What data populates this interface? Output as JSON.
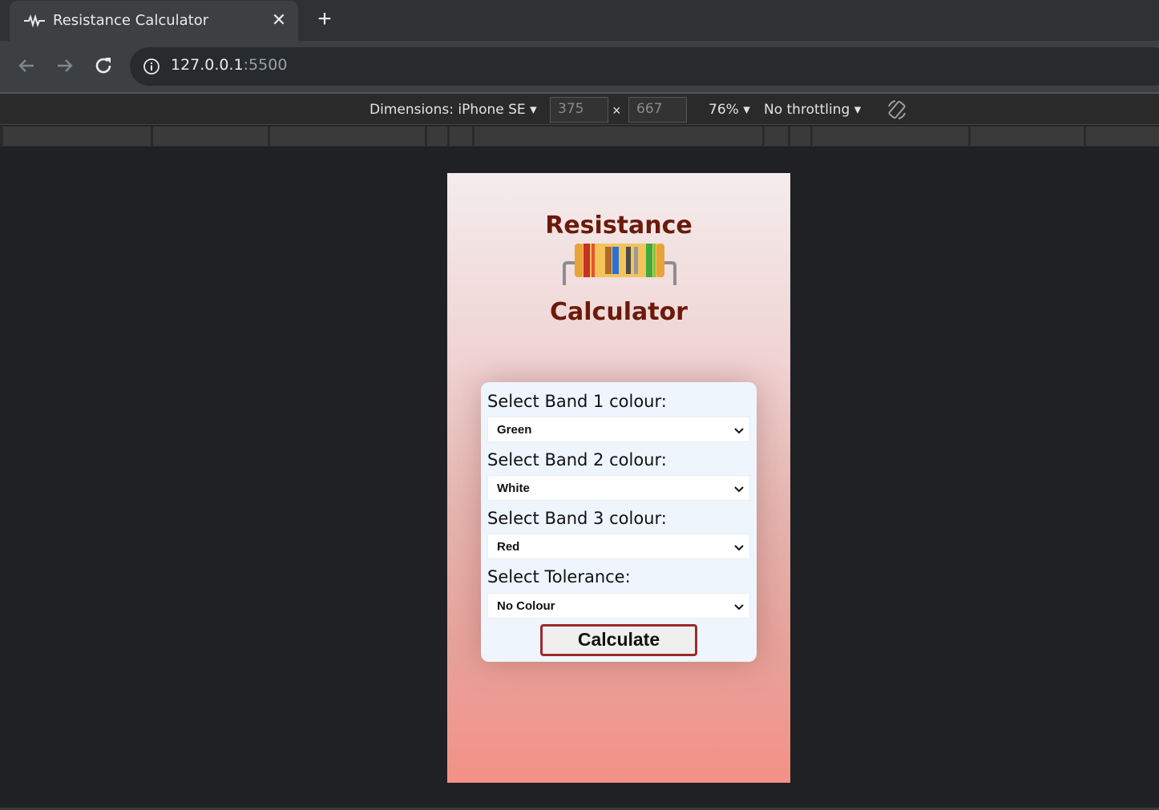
{
  "browser": {
    "tab_title": "Resistance Calculator",
    "url_host": "127.0.0.1",
    "url_port": ":5500"
  },
  "devtools": {
    "dimensions_label": "Dimensions: iPhone SE",
    "width_value": "375",
    "height_value": "667",
    "times": "×",
    "zoom": "76%",
    "throttling": "No throttling"
  },
  "app": {
    "title_top": "Resistance",
    "title_bottom": "Calculator",
    "fields": [
      {
        "label": "Select Band 1 colour:",
        "value": "Green"
      },
      {
        "label": "Select Band 2 colour:",
        "value": "White"
      },
      {
        "label": "Select Band 3 colour:",
        "value": "Red"
      },
      {
        "label": "Select Tolerance:",
        "value": "No Colour"
      }
    ],
    "calculate_label": "Calculate"
  },
  "colors": {
    "title": "#6b1a0a",
    "button_border": "#9b2b2b",
    "card": "#eef5fd"
  }
}
